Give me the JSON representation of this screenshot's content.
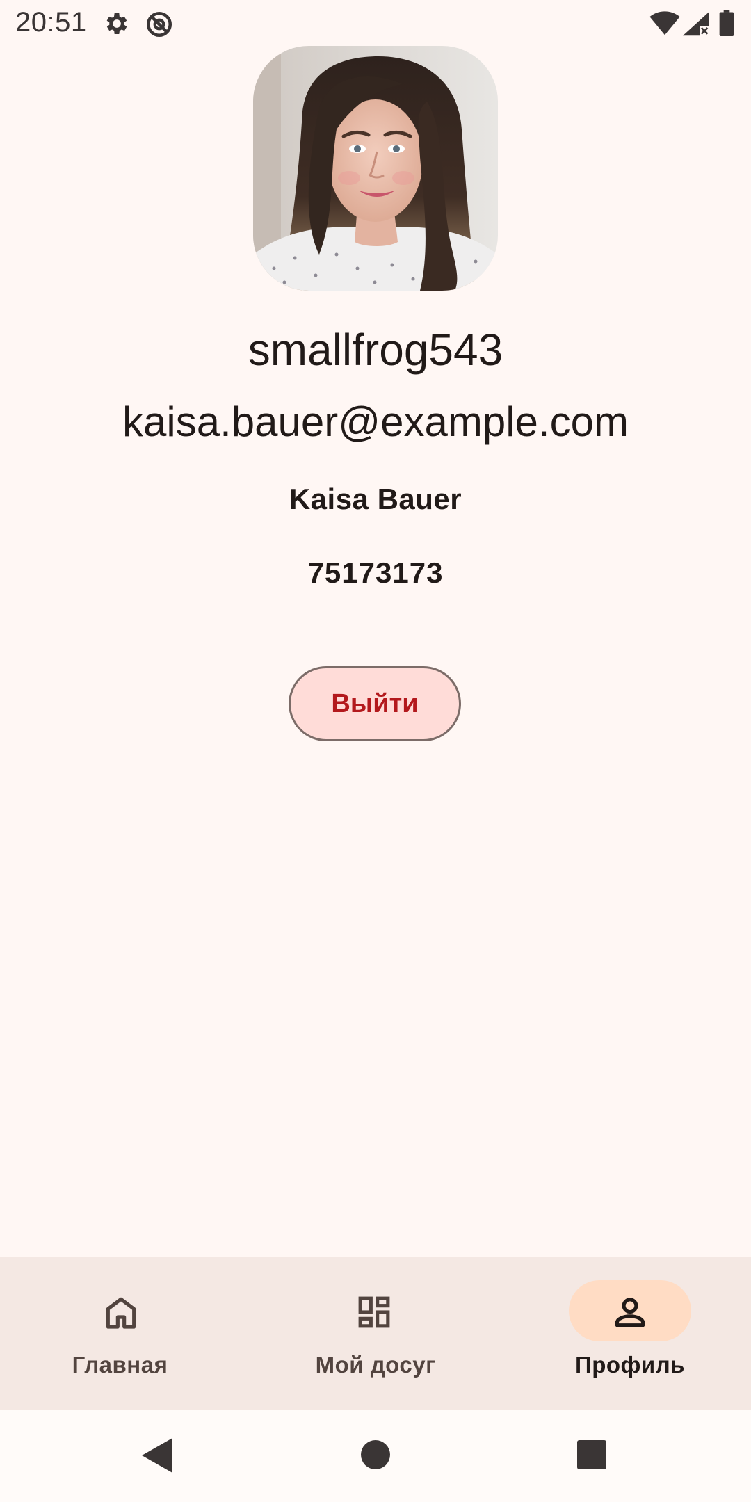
{
  "status_bar": {
    "time": "20:51",
    "left_icons": [
      "gear-icon",
      "no-sync-icon"
    ],
    "right_icons": [
      "wifi-icon",
      "cell-signal-icon",
      "battery-icon"
    ]
  },
  "profile": {
    "avatar": "profile-photo",
    "username": "smallfrog543",
    "email": "kaisa.bauer@example.com",
    "full_name": "Kaisa Bauer",
    "phone": "75173173"
  },
  "logout_label": "Выйти",
  "bottom_nav": {
    "items": [
      {
        "label": "Главная",
        "icon": "home-icon",
        "active": false
      },
      {
        "label": "Мой досуг",
        "icon": "grid-icon",
        "active": false
      },
      {
        "label": "Профиль",
        "icon": "person-icon",
        "active": true
      }
    ]
  },
  "system_nav": {
    "icons": [
      "back-icon",
      "home-circle-icon",
      "recents-icon"
    ]
  },
  "colors": {
    "background": "#fff7f4",
    "nav_background": "#f4e8e3",
    "active_pill": "#ffdcc4",
    "logout_background": "#ffdcd8",
    "logout_text": "#b3191d",
    "text": "#211a18"
  }
}
